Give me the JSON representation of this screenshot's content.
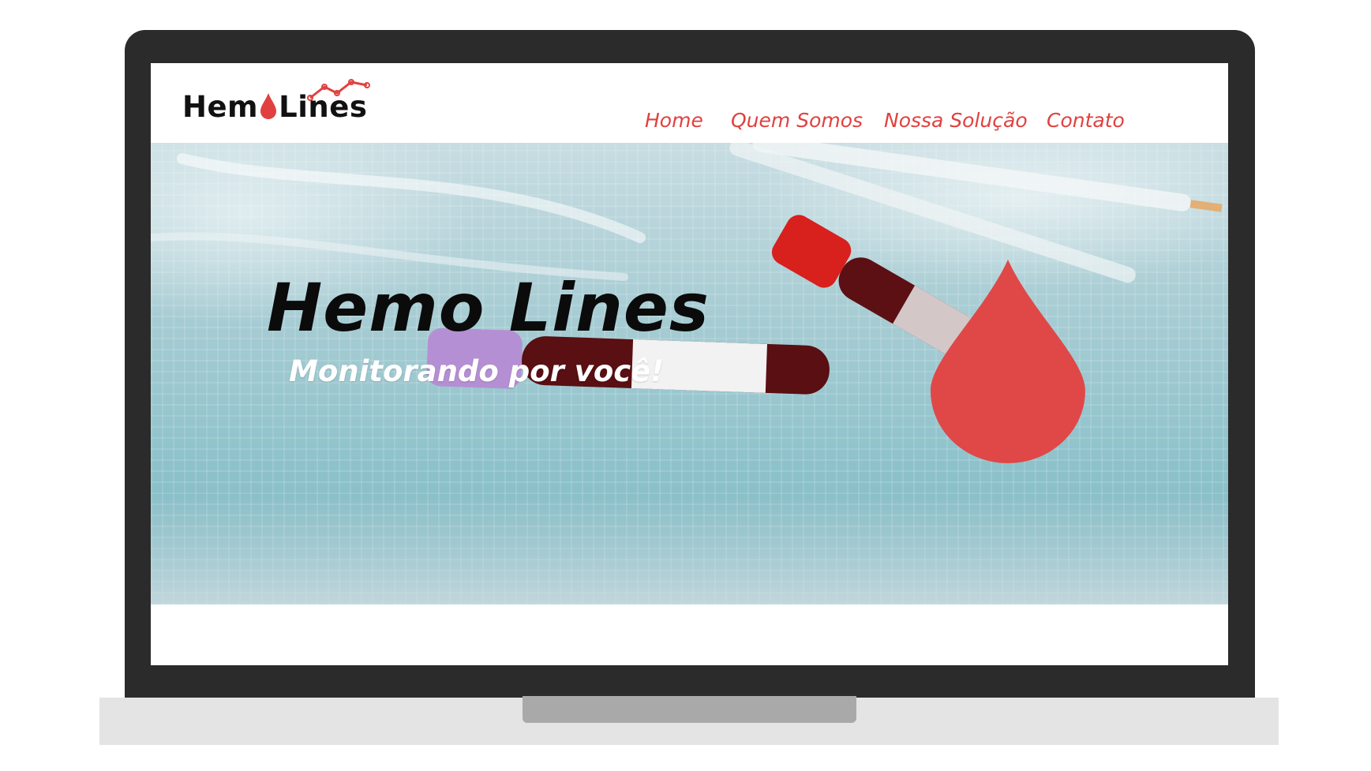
{
  "brand": {
    "logo_part1": "Hem",
    "logo_part2": "Lines",
    "accent_color": "#e0413f"
  },
  "nav": {
    "items": [
      {
        "label": "Home"
      },
      {
        "label": "Quem Somos"
      },
      {
        "label": "Nossa Solução"
      },
      {
        "label": "Contato"
      }
    ]
  },
  "hero": {
    "title": "Hemo Lines",
    "subtitle": "Monitorando por você!",
    "drop_icon": "blood-drop-icon",
    "drop_color": "#e04848"
  }
}
